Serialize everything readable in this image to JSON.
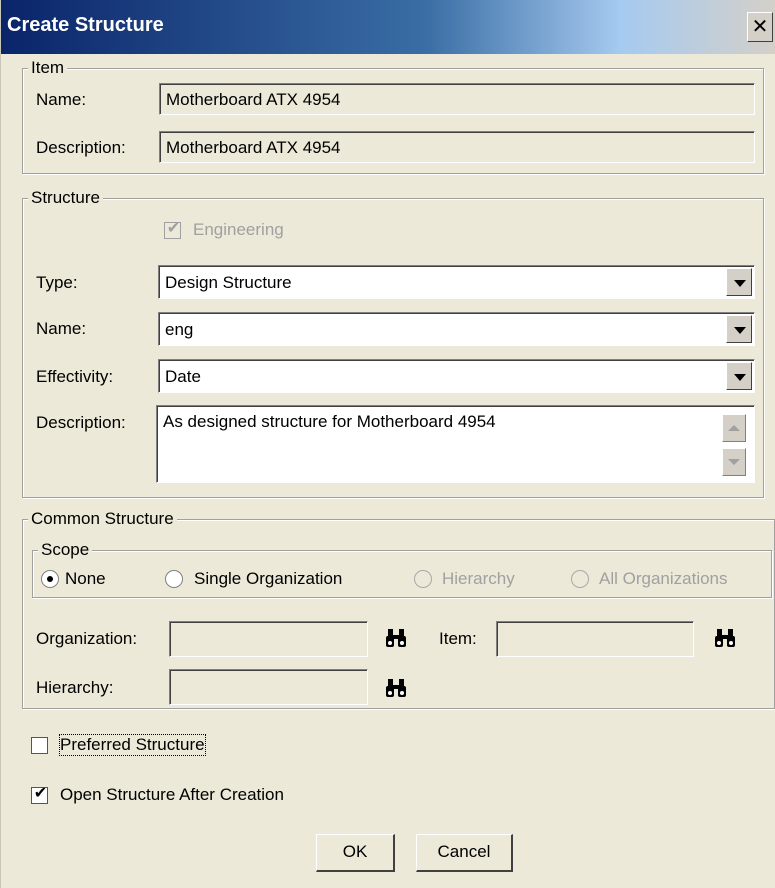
{
  "dialog": {
    "title": "Create Structure",
    "close_glyph": "✕"
  },
  "item_group": {
    "legend": "Item",
    "name_label": "Name:",
    "name_value": "Motherboard ATX 4954",
    "description_label": "Description:",
    "description_value": "Motherboard ATX 4954"
  },
  "structure_group": {
    "legend": "Structure",
    "engineering_label": "Engineering",
    "engineering_checked": true,
    "type_label": "Type:",
    "type_value": "Design Structure",
    "name_label": "Name:",
    "name_value": "eng",
    "effectivity_label": "Effectivity:",
    "effectivity_value": "Date",
    "description_label": "Description:",
    "description_value": "As designed structure for Motherboard 4954"
  },
  "common_group": {
    "legend": "Common Structure",
    "scope": {
      "legend": "Scope",
      "options": [
        {
          "label": "None",
          "selected": true,
          "enabled": true
        },
        {
          "label": "Single Organization",
          "selected": false,
          "enabled": true
        },
        {
          "label": "Hierarchy",
          "selected": false,
          "enabled": false
        },
        {
          "label": "All Organizations",
          "selected": false,
          "enabled": false
        }
      ]
    },
    "organization_label": "Organization:",
    "item_label": "Item:",
    "hierarchy_label": "Hierarchy:",
    "search_icon": "binoculars-icon"
  },
  "preferred_structure": {
    "label": "Preferred Structure",
    "checked": false
  },
  "open_after_creation": {
    "label": "Open Structure After Creation",
    "checked": true
  },
  "buttons": {
    "ok": "OK",
    "cancel": "Cancel"
  },
  "colors": {
    "title_start": "#0a246a",
    "title_end": "#a6caf0",
    "dialog_bg": "#ece9d8"
  }
}
